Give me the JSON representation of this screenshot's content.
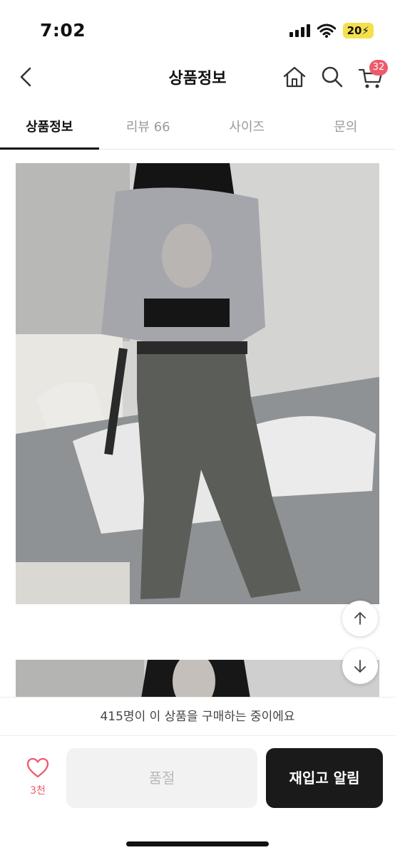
{
  "status_bar": {
    "time": "7:02",
    "battery_text": "20",
    "battery_color": "#f4e04d"
  },
  "nav": {
    "title": "상품정보",
    "cart_badge": "32",
    "icons": [
      "back-icon",
      "home-icon",
      "search-icon",
      "cart-icon"
    ],
    "badge_color": "#ef5a6b"
  },
  "tabs": [
    {
      "label": "상품정보",
      "active": true
    },
    {
      "label": "리뷰 66",
      "active": false
    },
    {
      "label": "사이즈",
      "active": false
    },
    {
      "label": "문의",
      "active": false
    }
  ],
  "bottom": {
    "banner_text": "415명이 이 상품을 구매하는 중이에요",
    "like_count": "3천",
    "soldout_label": "품절",
    "restock_label": "재입고 알림"
  }
}
